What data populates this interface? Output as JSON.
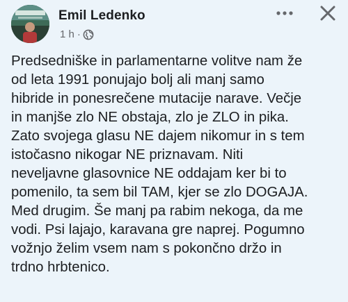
{
  "post": {
    "author": "Emil Ledenko",
    "timestamp": "1 h",
    "separator": "·",
    "privacy_icon": "globe-icon",
    "more_icon": "more-horizontal-icon",
    "close_icon": "close-icon",
    "body_lines": [
      "Predsedniške in parlamentarne volitve nam že",
      "od leta 1991 ponujajo bolj ali manj samo",
      "hibride in ponesrečene mutacije narave. Večje",
      "in manjše zlo NE obstaja, zlo je ZLO in pika.",
      "Zato svojega glasu NE dajem nikomur in s tem",
      "istočasno nikogar NE priznavam. Niti",
      "neveljavne glasovnice NE oddajam ker bi to",
      "pomenilo, ta sem bil TAM, kjer se zlo DOGAJA.",
      "Med drugim. Še manj pa rabim nekoga, da me",
      "vodi. Psi lajajo, karavana gre naprej. Pogumno",
      "vožnjo želim vsem nam s pokončno držo in",
      "trdno hrbtenico."
    ]
  },
  "colors": {
    "background": "#ecf4fa",
    "text_primary": "#1c1e21",
    "text_secondary": "#65676b"
  }
}
